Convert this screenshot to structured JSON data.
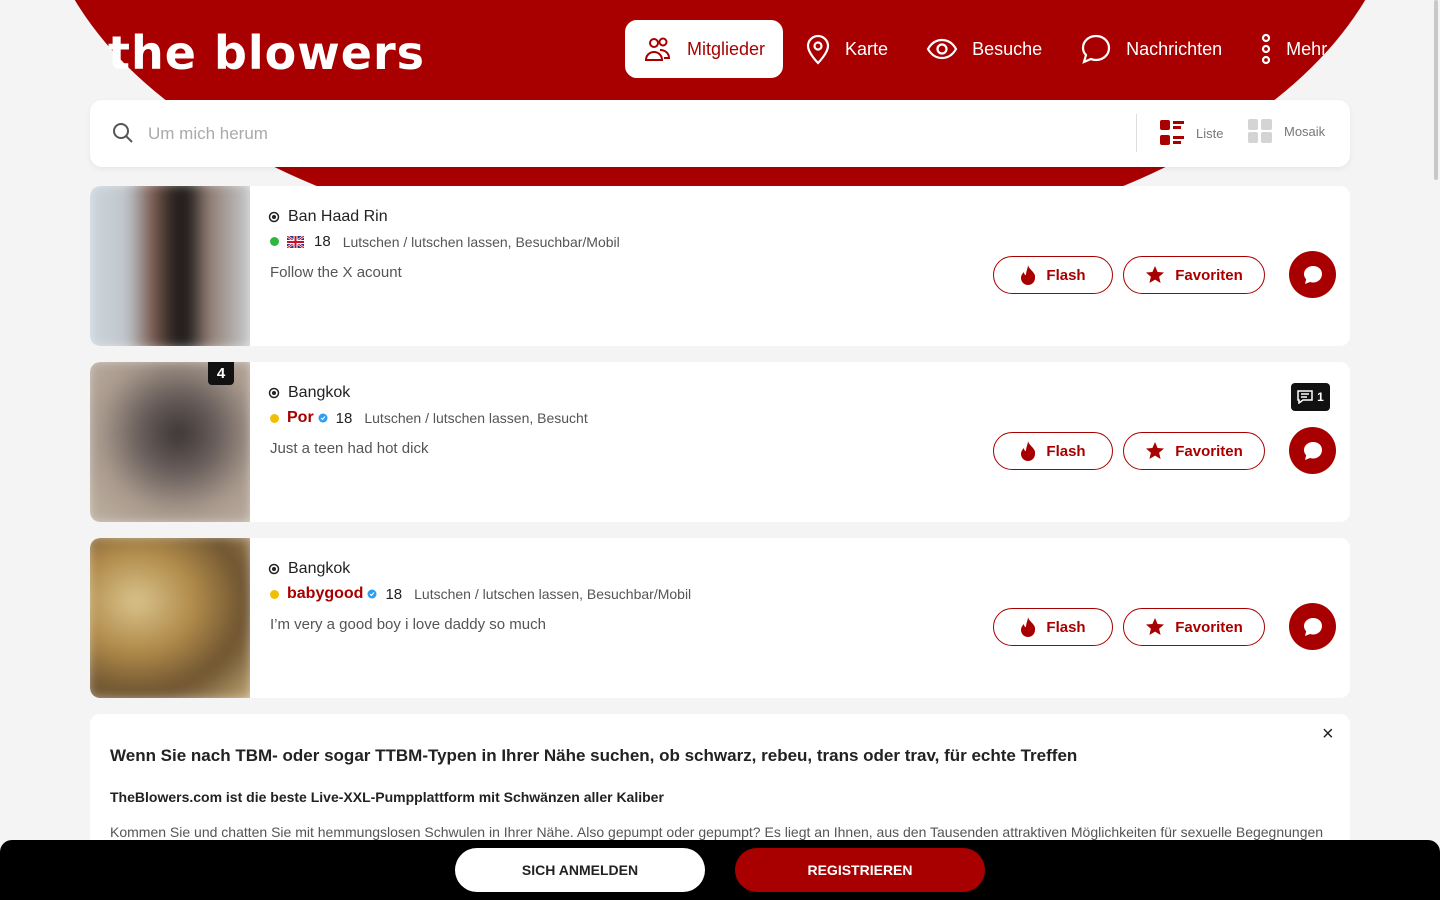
{
  "brand": {
    "logo": "the blowers",
    "accent": "#a80000"
  },
  "nav": {
    "items": [
      {
        "label": "Mitglieder",
        "icon": "members-icon",
        "active": true
      },
      {
        "label": "Karte",
        "icon": "map-pin-icon"
      },
      {
        "label": "Besuche",
        "icon": "eye-icon"
      },
      {
        "label": "Nachrichten",
        "icon": "chat-icon"
      },
      {
        "label": "Mehr",
        "icon": "more-vertical-icon"
      }
    ]
  },
  "search": {
    "placeholder": "Um mich herum",
    "value": ""
  },
  "view_options": {
    "list_label": "Liste",
    "mosaic_label": "Mosaik"
  },
  "profiles": [
    {
      "location": "Ban Haad Rin",
      "status_color": "#2db83d",
      "flag": "uk-flag-icon",
      "username": "",
      "age": "18",
      "tags": "Lutschen / lutschen lassen, Besuchbar/Mobil",
      "description": "Follow the X acount",
      "photo_count": "",
      "message_count": ""
    },
    {
      "location": "Bangkok",
      "status_color": "#f0c000",
      "flag": "",
      "username": "Por",
      "age": "18",
      "tags": "Lutschen / lutschen lassen, Besucht",
      "description": "Just a teen had hot dick",
      "photo_count": "4",
      "message_count": "1"
    },
    {
      "location": "Bangkok",
      "status_color": "#f0c000",
      "flag": "",
      "username": "babygood",
      "age": "18",
      "tags": "Lutschen / lutschen lassen, Besuchbar/Mobil",
      "description": "I’m very a good boy i love daddy so much",
      "photo_count": "",
      "message_count": ""
    }
  ],
  "actions": {
    "flash_label": "Flash",
    "favorite_label": "Favoriten"
  },
  "info": {
    "title": "Wenn Sie nach TBM- oder sogar TTBM-Typen in Ihrer Nähe suchen, ob schwarz, rebeu, trans oder trav, für echte Treffen",
    "subtitle": "TheBlowers.com ist die beste Live-XXL-Pumpplattform mit Schwänzen aller Kaliber",
    "body": "Kommen Sie und chatten Sie mit hemmungslosen Schwulen in Ihrer Nähe. Also gepumpt oder gepumpt? Es liegt an Ihnen, aus den Tausenden attraktiven Möglichkeiten für sexuelle Begegnungen",
    "close": "×"
  },
  "bottom_bar": {
    "login_label": "SICH ANMELDEN",
    "register_label": "REGISTRIEREN"
  }
}
